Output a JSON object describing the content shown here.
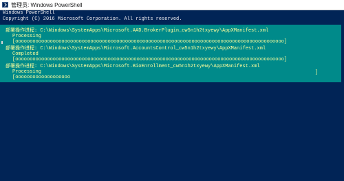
{
  "window": {
    "title": "管理员: Windows PowerShell",
    "background": "#012456",
    "progress_background": "#008a8a",
    "progress_text_color": "#ffff9c"
  },
  "console": {
    "header_lines": [
      "Windows PowerShell",
      "Copyright (C) 2016 Microsoft Corporation. All rights reserved."
    ]
  },
  "progress": [
    {
      "title": "部署操作进程: C:\\Windows\\SystemApps\\Microsoft.AAD.BrokerPlugin_cw5n1h2txyewy\\AppXManifest.xml",
      "status": "Processing",
      "bar": "[ooooooooooooooooooooooooooooooooooooooooooooooooooooooooooooooooooooooooooooooooooooooooooooo]"
    },
    {
      "title": "部署操作进程: C:\\Windows\\SystemApps\\Microsoft.AccountsControl_cw5n1h2txyewy\\AppXManifest.xml",
      "status": "Completed",
      "bar": "[ooooooooooooooooooooooooooooooooooooooooooooooooooooooooooooooooooooooooooooooooooooooooooooo]"
    },
    {
      "title": "部署操作进程: C:\\Windows\\SystemApps\\Microsoft.BioEnrollment_cw5n1h2txyewy\\AppXManifest.xml",
      "status": "Processing",
      "bar": "[ooooooooooooooooooo",
      "bar_close": "]"
    }
  ]
}
